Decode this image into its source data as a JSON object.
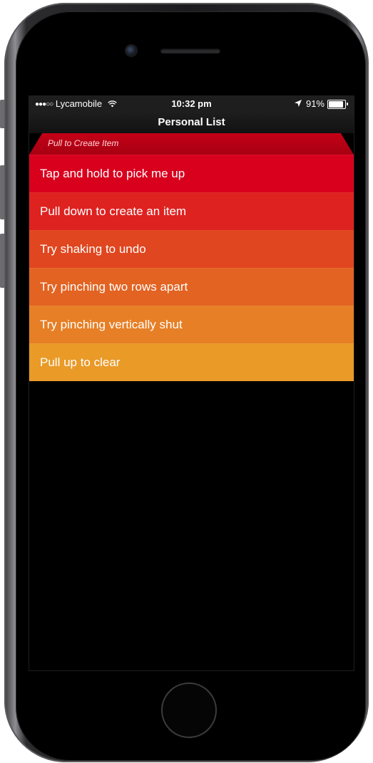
{
  "status_bar": {
    "carrier": "Lycamobile",
    "signal_dots": "●●●○○",
    "wifi_icon": "wifi-icon",
    "time": "10:32 pm",
    "location_icon": "location-arrow-icon",
    "battery_percent": "91%",
    "battery_level": 0.91
  },
  "nav": {
    "title": "Personal List"
  },
  "pull_hint": "Pull to Create Item",
  "items": [
    {
      "label": "Tap and hold to pick me up",
      "color": "#d9001e"
    },
    {
      "label": "Pull down to create an item",
      "color": "#de2220"
    },
    {
      "label": "Try shaking to undo",
      "color": "#e0461f"
    },
    {
      "label": "Try pinching two rows apart",
      "color": "#e36322"
    },
    {
      "label": "Try pinching vertically shut",
      "color": "#e67f25"
    },
    {
      "label": "Pull up to clear",
      "color": "#e99a27"
    }
  ]
}
